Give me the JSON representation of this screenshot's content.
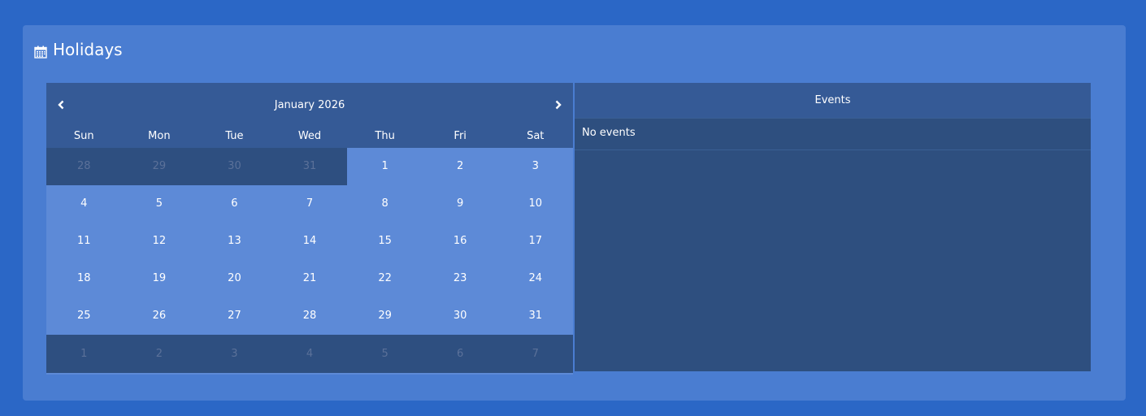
{
  "panel": {
    "title": "Holidays",
    "icon": "calendar-icon"
  },
  "calendar": {
    "month_label": "January 2026",
    "prev_icon": "chevron-left-icon",
    "next_icon": "chevron-right-icon",
    "weekdays": [
      "Sun",
      "Mon",
      "Tue",
      "Wed",
      "Thu",
      "Fri",
      "Sat"
    ],
    "weeks": [
      [
        {
          "day": "28",
          "current": false
        },
        {
          "day": "29",
          "current": false
        },
        {
          "day": "30",
          "current": false
        },
        {
          "day": "31",
          "current": false
        },
        {
          "day": "1",
          "current": true
        },
        {
          "day": "2",
          "current": true
        },
        {
          "day": "3",
          "current": true
        }
      ],
      [
        {
          "day": "4",
          "current": true
        },
        {
          "day": "5",
          "current": true
        },
        {
          "day": "6",
          "current": true
        },
        {
          "day": "7",
          "current": true
        },
        {
          "day": "8",
          "current": true
        },
        {
          "day": "9",
          "current": true
        },
        {
          "day": "10",
          "current": true
        }
      ],
      [
        {
          "day": "11",
          "current": true
        },
        {
          "day": "12",
          "current": true
        },
        {
          "day": "13",
          "current": true
        },
        {
          "day": "14",
          "current": true
        },
        {
          "day": "15",
          "current": true
        },
        {
          "day": "16",
          "current": true
        },
        {
          "day": "17",
          "current": true
        }
      ],
      [
        {
          "day": "18",
          "current": true
        },
        {
          "day": "19",
          "current": true
        },
        {
          "day": "20",
          "current": true
        },
        {
          "day": "21",
          "current": true
        },
        {
          "day": "22",
          "current": true
        },
        {
          "day": "23",
          "current": true
        },
        {
          "day": "24",
          "current": true
        }
      ],
      [
        {
          "day": "25",
          "current": true
        },
        {
          "day": "26",
          "current": true
        },
        {
          "day": "27",
          "current": true
        },
        {
          "day": "28",
          "current": true
        },
        {
          "day": "29",
          "current": true
        },
        {
          "day": "30",
          "current": true
        },
        {
          "day": "31",
          "current": true
        }
      ],
      [
        {
          "day": "1",
          "current": false
        },
        {
          "day": "2",
          "current": false
        },
        {
          "day": "3",
          "current": false
        },
        {
          "day": "4",
          "current": false
        },
        {
          "day": "5",
          "current": false
        },
        {
          "day": "6",
          "current": false
        },
        {
          "day": "7",
          "current": false
        }
      ]
    ]
  },
  "events": {
    "header": "Events",
    "empty_text": "No events"
  },
  "colors": {
    "page_bg": "#2b67c6",
    "panel_bg": "#4a7dd1",
    "header_bg": "#355a96",
    "current_day_bg": "#5d8ad7",
    "other_day_bg": "#2e4f80",
    "events_bg": "#2e4f7f"
  }
}
